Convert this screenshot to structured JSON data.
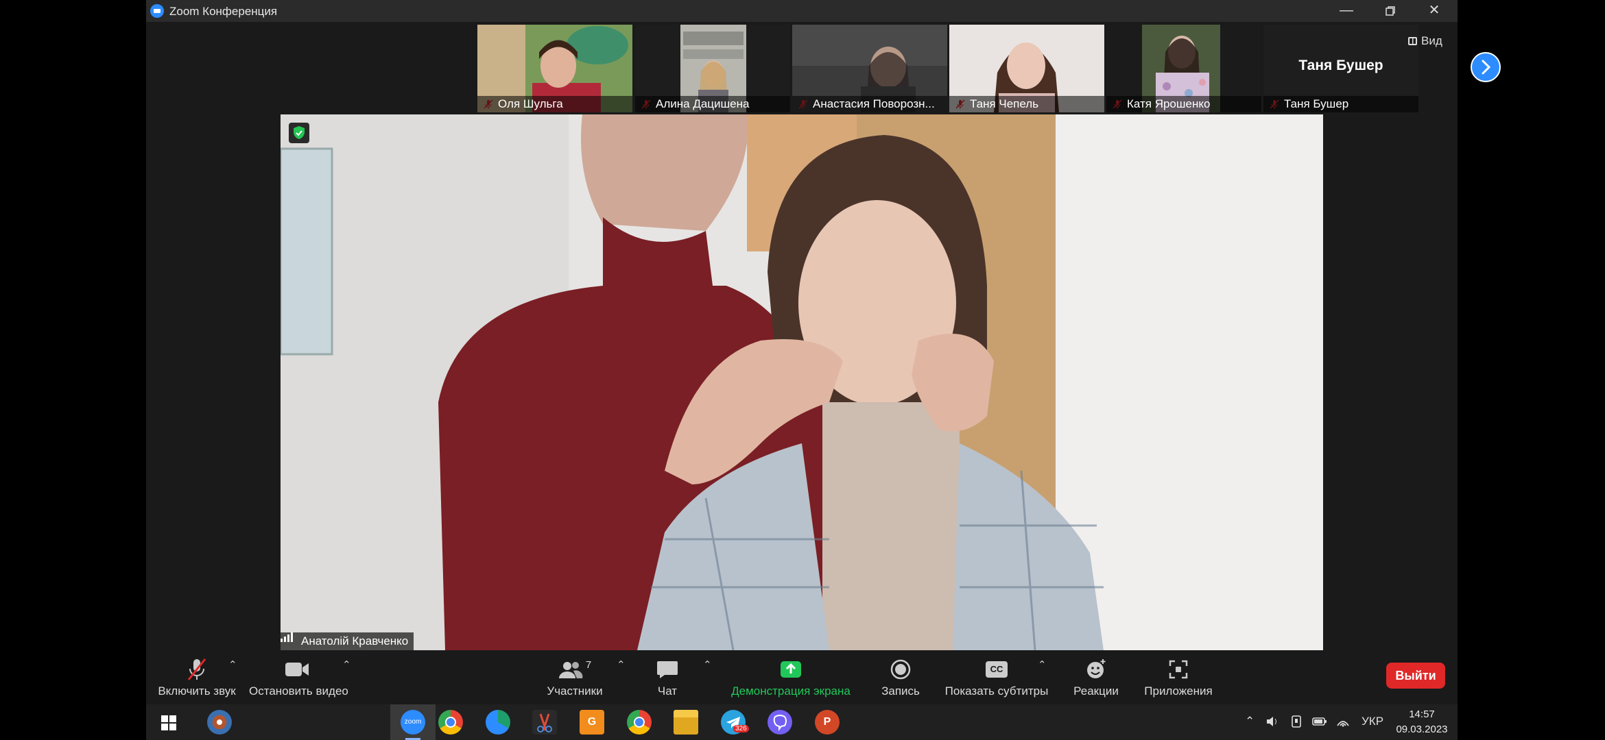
{
  "window": {
    "title": "Zoom Конференция",
    "icon": "zoom-logo"
  },
  "participants": [
    {
      "name": "Оля Шульга",
      "video": true
    },
    {
      "name": "Алина Дацишена",
      "video": true
    },
    {
      "name": "Анастасия Поворозн...",
      "video": true
    },
    {
      "name": "Таня Чепель",
      "video": true
    },
    {
      "name": "Катя Ярошенко",
      "video": true
    },
    {
      "name": "Таня Бушер",
      "video": false,
      "display_name": "Таня Бушер"
    }
  ],
  "view_button": "Вид",
  "main_speaker": {
    "name": "Анатолій Кравченко"
  },
  "toolbar": {
    "unmute": "Включить звук",
    "stop_video": "Остановить видео",
    "participants": "Участники",
    "participants_count": "7",
    "chat": "Чат",
    "share": "Демонстрация экрана",
    "record": "Запись",
    "captions": "Показать субтитры",
    "captions_icon_text": "CC",
    "reactions": "Реакции",
    "apps": "Приложения",
    "leave": "Выйти"
  },
  "taskbar": {
    "language": "УКР",
    "time": "14:57",
    "date": "09.03.2023",
    "telegram_badge": "326",
    "zoom_icon_text": "zoom"
  },
  "colors": {
    "accent": "#2d8cff",
    "leave": "#e02828",
    "share": "#22c75a",
    "muted": "#e02828"
  }
}
